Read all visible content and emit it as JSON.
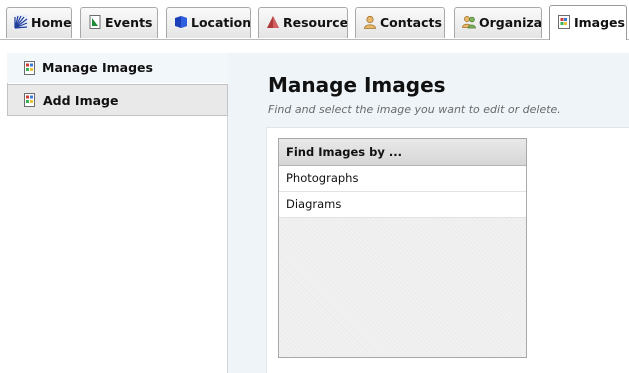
{
  "tabs": [
    {
      "label": "Home",
      "icon": "home-icon"
    },
    {
      "label": "Events",
      "icon": "events-icon"
    },
    {
      "label": "Locations",
      "icon": "locations-icon"
    },
    {
      "label": "Resources",
      "icon": "resources-icon"
    },
    {
      "label": "Contacts",
      "icon": "contacts-icon"
    },
    {
      "label": "Organizat",
      "icon": "organizations-icon"
    },
    {
      "label": "Images",
      "icon": "images-icon",
      "active": true
    }
  ],
  "sidebar": {
    "items": [
      {
        "label": "Manage Images",
        "icon": "image-file-icon",
        "active": true
      },
      {
        "label": "Add Image",
        "icon": "image-file-icon",
        "active": false
      }
    ]
  },
  "main": {
    "title": "Manage Images",
    "subtitle": "Find and select the image you want to edit or delete.",
    "finder": {
      "header": "Find Images by ...",
      "rows": [
        "Photographs",
        "Diagrams"
      ]
    }
  },
  "colors": {
    "main_background": "#eef4f8",
    "sidebar_active_background": "#f2f7fa",
    "sidebar_item_background": "#e9e9e9",
    "subtitle_text": "#6a6a6a"
  }
}
